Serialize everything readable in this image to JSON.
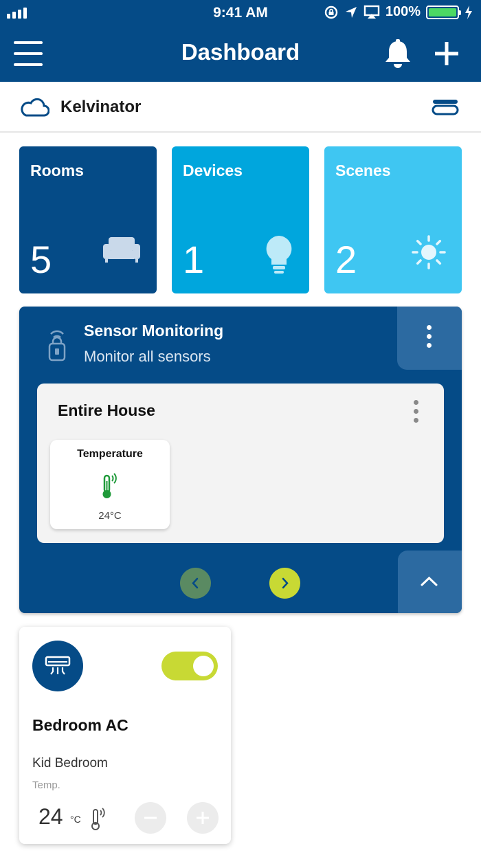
{
  "status_bar": {
    "time": "9:41 AM",
    "battery": "100%"
  },
  "header": {
    "title": "Dashboard"
  },
  "home": {
    "name": "Kelvinator"
  },
  "tiles": [
    {
      "label": "Rooms",
      "count": "5",
      "color": "#054b87",
      "icon": "sofa-icon"
    },
    {
      "label": "Devices",
      "count": "1",
      "color": "#00a6dd",
      "icon": "lightbulb-icon"
    },
    {
      "label": "Scenes",
      "count": "2",
      "color": "#3fc6f2",
      "icon": "sun-icon"
    }
  ],
  "sensor_monitoring": {
    "title": "Sensor Monitoring",
    "subtitle": "Monitor all sensors",
    "zone": {
      "title": "Entire House",
      "sensor": {
        "label": "Temperature",
        "value": "24°C",
        "icon": "thermometer-icon"
      }
    }
  },
  "device_card": {
    "name": "Bedroom AC",
    "room": "Kid Bedroom",
    "temp_label": "Temp.",
    "temp_value": "24",
    "temp_unit": "°C",
    "power_on": true,
    "icon": "air-conditioner-icon"
  },
  "colors": {
    "primary": "#054b87",
    "accent": "#c8d934",
    "sensor_green": "#1f9a3a"
  }
}
